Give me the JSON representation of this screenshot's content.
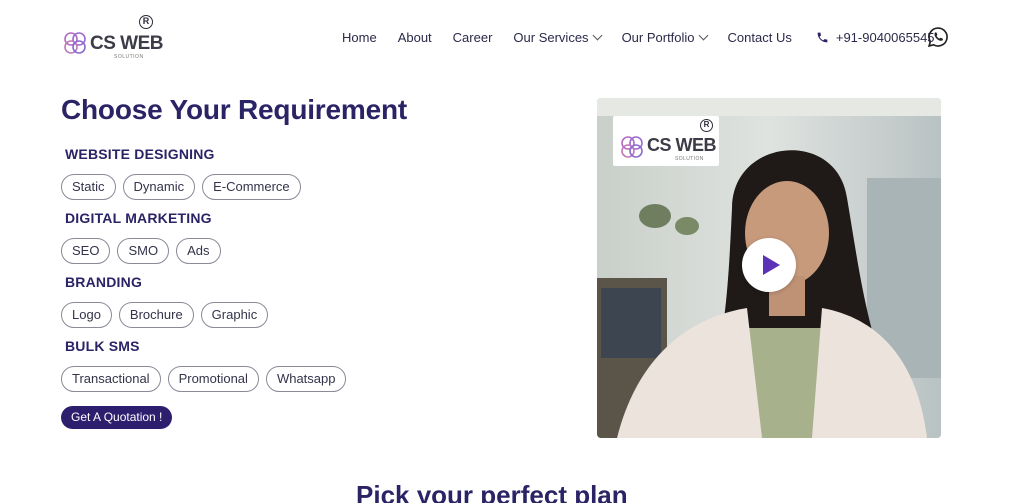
{
  "header": {
    "logo": {
      "brand": "CS WEB",
      "sub": "SOLUTION",
      "reg": "R"
    },
    "nav": [
      {
        "label": "Home",
        "dropdown": false
      },
      {
        "label": "About",
        "dropdown": false
      },
      {
        "label": "Career",
        "dropdown": false
      },
      {
        "label": "Our Services",
        "dropdown": true
      },
      {
        "label": "Our Portfolio",
        "dropdown": true
      },
      {
        "label": "Contact Us",
        "dropdown": false
      }
    ],
    "phone": "+91-9040065545",
    "icons": {
      "phone": "phone-icon",
      "whatsapp": "whatsapp-icon"
    }
  },
  "main": {
    "title": "Choose Your Requirement",
    "sections": [
      {
        "heading": "WEBSITE DESIGNING",
        "options": [
          "Static",
          "Dynamic",
          "E-Commerce"
        ]
      },
      {
        "heading": "DIGITAL MARKETING",
        "options": [
          "SEO",
          "SMO",
          "Ads"
        ]
      },
      {
        "heading": "BRANDING",
        "options": [
          "Logo",
          "Brochure",
          "Graphic"
        ]
      },
      {
        "heading": "BULK SMS",
        "options": [
          "Transactional",
          "Promotional",
          "Whatsapp"
        ]
      }
    ],
    "quote_button": "Get A Quotation !"
  },
  "video": {
    "logo": {
      "brand": "CS WEB",
      "sub": "SOLUTION",
      "reg": "R"
    },
    "play_icon": "play-icon"
  },
  "bottom": {
    "title": "Pick your perfect plan"
  },
  "colors": {
    "primary": "#2a2466",
    "button": "#2d1f6e",
    "play": "#5a33b8"
  }
}
